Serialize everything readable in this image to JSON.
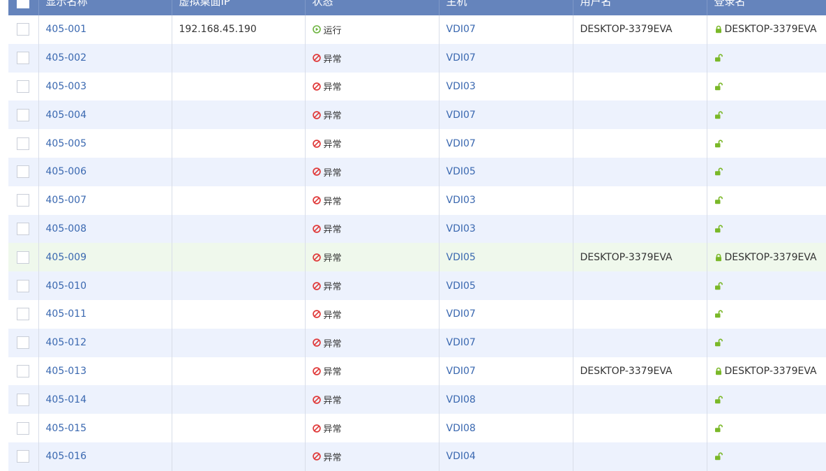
{
  "columns": {
    "checkbox": "",
    "name": "显示名称",
    "ip": "虚拟桌面IP",
    "status": "状态",
    "host": "主机",
    "user": "用户名",
    "login": "登录名"
  },
  "colors": {
    "header_bg": "#6584bc",
    "link": "#3a68b0",
    "running": "#6cb33e",
    "error": "#e03a3a",
    "lock": "#7ab828"
  },
  "rows": [
    {
      "name": "405-001",
      "ip": "192.168.45.190",
      "status": "运行",
      "status_type": "running",
      "host": "VDI07",
      "user": "DESKTOP-3379EVA",
      "login": "DESKTOP-3379EVA",
      "lock_icon": "lock-closed-icon"
    },
    {
      "name": "405-002",
      "ip": "",
      "status": "异常",
      "status_type": "error",
      "host": "VDI07",
      "user": "",
      "login": "",
      "lock_icon": "lock-open-icon"
    },
    {
      "name": "405-003",
      "ip": "",
      "status": "异常",
      "status_type": "error",
      "host": "VDI03",
      "user": "",
      "login": "",
      "lock_icon": "lock-open-icon"
    },
    {
      "name": "405-004",
      "ip": "",
      "status": "异常",
      "status_type": "error",
      "host": "VDI07",
      "user": "",
      "login": "",
      "lock_icon": "lock-open-icon"
    },
    {
      "name": "405-005",
      "ip": "",
      "status": "异常",
      "status_type": "error",
      "host": "VDI07",
      "user": "",
      "login": "",
      "lock_icon": "lock-open-icon"
    },
    {
      "name": "405-006",
      "ip": "",
      "status": "异常",
      "status_type": "error",
      "host": "VDI05",
      "user": "",
      "login": "",
      "lock_icon": "lock-open-icon"
    },
    {
      "name": "405-007",
      "ip": "",
      "status": "异常",
      "status_type": "error",
      "host": "VDI03",
      "user": "",
      "login": "",
      "lock_icon": "lock-open-icon"
    },
    {
      "name": "405-008",
      "ip": "",
      "status": "异常",
      "status_type": "error",
      "host": "VDI03",
      "user": "",
      "login": "",
      "lock_icon": "lock-open-icon"
    },
    {
      "name": "405-009",
      "ip": "",
      "status": "异常",
      "status_type": "error",
      "host": "VDI05",
      "user": "DESKTOP-3379EVA",
      "login": "DESKTOP-3379EVA",
      "lock_icon": "lock-closed-icon",
      "hover": true
    },
    {
      "name": "405-010",
      "ip": "",
      "status": "异常",
      "status_type": "error",
      "host": "VDI05",
      "user": "",
      "login": "",
      "lock_icon": "lock-open-icon"
    },
    {
      "name": "405-011",
      "ip": "",
      "status": "异常",
      "status_type": "error",
      "host": "VDI07",
      "user": "",
      "login": "",
      "lock_icon": "lock-open-icon"
    },
    {
      "name": "405-012",
      "ip": "",
      "status": "异常",
      "status_type": "error",
      "host": "VDI07",
      "user": "",
      "login": "",
      "lock_icon": "lock-open-icon"
    },
    {
      "name": "405-013",
      "ip": "",
      "status": "异常",
      "status_type": "error",
      "host": "VDI07",
      "user": "DESKTOP-3379EVA",
      "login": "DESKTOP-3379EVA",
      "lock_icon": "lock-closed-icon"
    },
    {
      "name": "405-014",
      "ip": "",
      "status": "异常",
      "status_type": "error",
      "host": "VDI08",
      "user": "",
      "login": "",
      "lock_icon": "lock-open-icon"
    },
    {
      "name": "405-015",
      "ip": "",
      "status": "异常",
      "status_type": "error",
      "host": "VDI08",
      "user": "",
      "login": "",
      "lock_icon": "lock-open-icon"
    },
    {
      "name": "405-016",
      "ip": "",
      "status": "异常",
      "status_type": "error",
      "host": "VDI04",
      "user": "",
      "login": "",
      "lock_icon": "lock-open-icon"
    }
  ]
}
